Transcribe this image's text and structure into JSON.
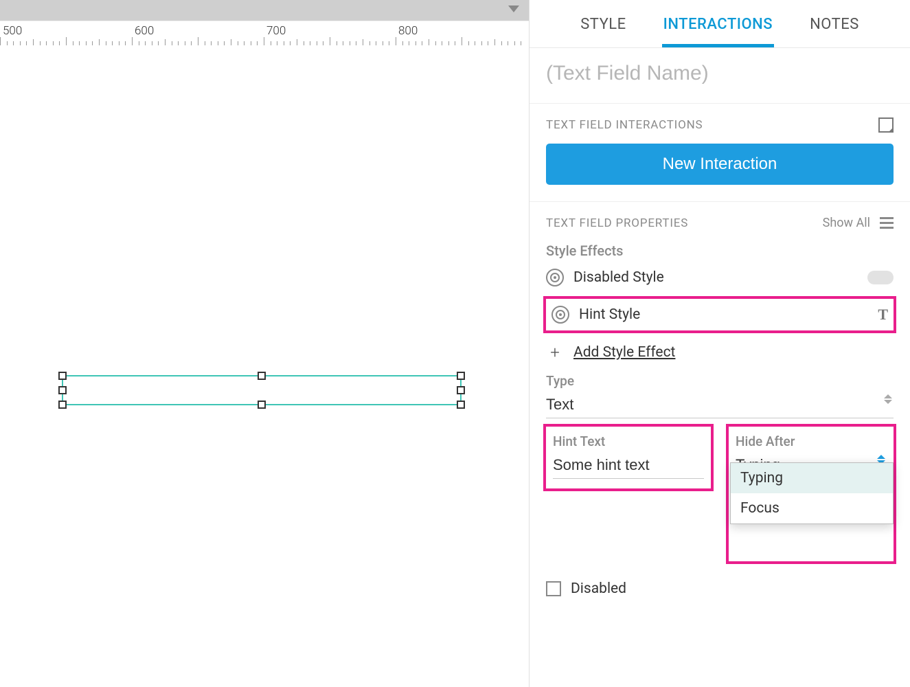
{
  "ruler": {
    "labels": [
      "500",
      "600",
      "700",
      "800"
    ]
  },
  "tabs": {
    "style": "STYLE",
    "interactions": "INTERACTIONS",
    "notes": "NOTES",
    "active": "interactions"
  },
  "name_placeholder": "(Text Field Name)",
  "interactions": {
    "heading": "TEXT FIELD INTERACTIONS",
    "new_btn": "New Interaction"
  },
  "properties": {
    "heading": "TEXT FIELD PROPERTIES",
    "show_all": "Show All",
    "style_effects_label": "Style Effects",
    "disabled_style": "Disabled Style",
    "hint_style": "Hint Style",
    "add_effect": "Add Style Effect",
    "type_label": "Type",
    "type_value": "Text",
    "hint_text_label": "Hint Text",
    "hint_text_value": "Some hint text",
    "hide_after_label": "Hide After",
    "hide_after_value": "Typing",
    "hide_after_options": [
      "Typing",
      "Focus"
    ],
    "disabled_label": "Disabled"
  }
}
